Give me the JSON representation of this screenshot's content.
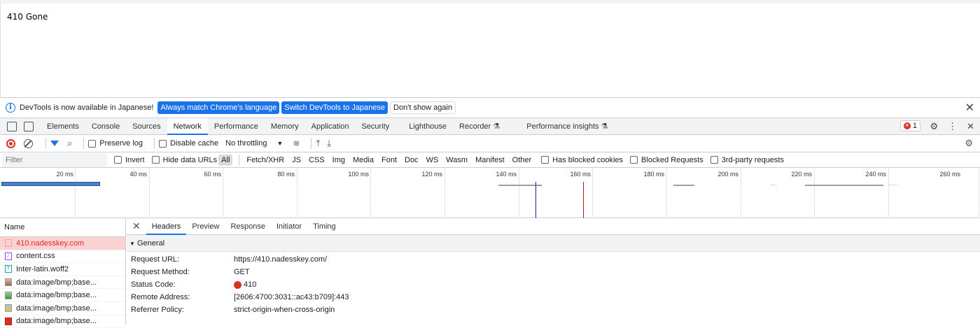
{
  "page": {
    "text": "410 Gone"
  },
  "infobar": {
    "message": "DevTools is now available in Japanese!",
    "btn_match": "Always match Chrome's language",
    "btn_switch": "Switch DevTools to Japanese",
    "btn_dont": "Don't show again"
  },
  "tabs": [
    "Elements",
    "Console",
    "Sources",
    "Network",
    "Performance",
    "Memory",
    "Application",
    "Security",
    "Lighthouse",
    "Recorder",
    "Performance insights"
  ],
  "active_tab": "Network",
  "error_count": "1",
  "toolbar": {
    "preserve_log": "Preserve log",
    "disable_cache": "Disable cache",
    "throttling": "No throttling"
  },
  "filterbar": {
    "placeholder": "Filter",
    "invert": "Invert",
    "hide_data_urls": "Hide data URLs",
    "types": [
      "All",
      "Fetch/XHR",
      "JS",
      "CSS",
      "Img",
      "Media",
      "Font",
      "Doc",
      "WS",
      "Wasm",
      "Manifest",
      "Other"
    ],
    "has_blocked_cookies": "Has blocked cookies",
    "blocked_requests": "Blocked Requests",
    "third_party": "3rd-party requests"
  },
  "timeline": {
    "ticks": [
      "20 ms",
      "40 ms",
      "60 ms",
      "80 ms",
      "100 ms",
      "120 ms",
      "140 ms",
      "160 ms",
      "180 ms",
      "200 ms",
      "220 ms",
      "240 ms",
      "260 ms"
    ]
  },
  "names": {
    "header": "Name",
    "rows": [
      "410.nadesskey.com",
      "content.css",
      "Inter-latin.woff2",
      "data:image/bmp;base...",
      "data:image/bmp;base...",
      "data:image/bmp;base...",
      "data:image/bmp;base..."
    ]
  },
  "detail": {
    "tabs": [
      "Headers",
      "Preview",
      "Response",
      "Initiator",
      "Timing"
    ],
    "section": "General",
    "fields": [
      {
        "k": "Request URL:",
        "v": "https://410.nadesskey.com/"
      },
      {
        "k": "Request Method:",
        "v": "GET"
      },
      {
        "k": "Status Code:",
        "v": "410"
      },
      {
        "k": "Remote Address:",
        "v": "[2606:4700:3031::ac43:b709]:443"
      },
      {
        "k": "Referrer Policy:",
        "v": "strict-origin-when-cross-origin"
      }
    ]
  },
  "colors": {
    "accent": "#1a73e8",
    "error": "#d93025",
    "selected_row": "#fbd1d1"
  }
}
